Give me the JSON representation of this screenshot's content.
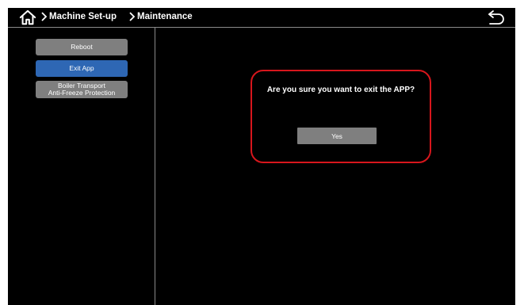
{
  "header": {
    "breadcrumb": [
      {
        "label": "Machine Set-up"
      },
      {
        "label": "Maintenance"
      }
    ],
    "home_icon": "home-icon",
    "back_icon": "back-arrow-icon"
  },
  "sidebar": {
    "items": [
      {
        "label": "Reboot",
        "active": false
      },
      {
        "label": "Exit App",
        "active": true
      },
      {
        "label_line1": "Boiler Transport",
        "label_line2": "Anti-Freeze Protection",
        "active": false
      }
    ]
  },
  "dialog": {
    "message": "Are you sure you want to exit the APP?",
    "confirm_label": "Yes",
    "border_color": "#d7161c"
  },
  "colors": {
    "background": "#000000",
    "button": "#7f7f7f",
    "active_button": "#2e67b4",
    "text": "#ffffff"
  }
}
